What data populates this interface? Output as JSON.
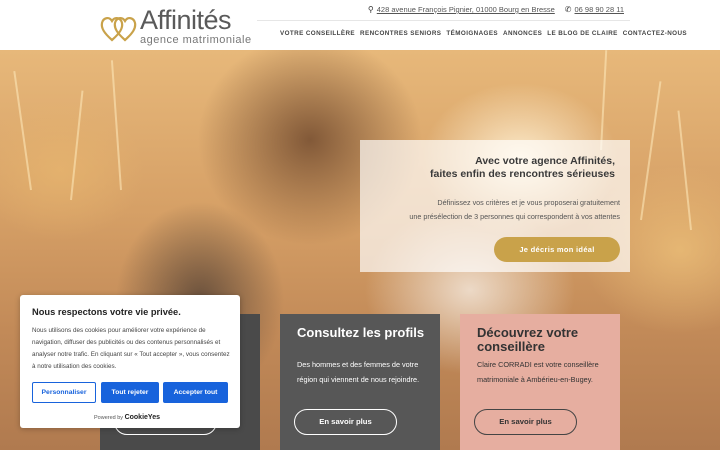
{
  "logo": {
    "title": "Affinités",
    "subtitle": "agence matrimoniale"
  },
  "topbar": {
    "address": "428 avenue François Pignier, 01000 Bourg en Bresse",
    "phone": "06 98 90 28 11"
  },
  "nav": [
    "VOTRE CONSEILLÈRE",
    "RENCONTRES SENIORS",
    "TÉMOIGNAGES",
    "ANNONCES",
    "LE BLOG DE CLAIRE",
    "CONTACTEZ-NOUS"
  ],
  "hero": {
    "title_line1": "Avec votre agence Affinités,",
    "title_line2": "faites enfin des rencontres sérieuses",
    "text_line1": "Définissez vos critères et je vous proposerai gratuitement",
    "text_line2": "une présélection de 3 personnes qui correspondent à vos attentes",
    "button": "Je décris mon idéal"
  },
  "cards": [
    {
      "title": "",
      "text": "",
      "button": ""
    },
    {
      "title": "Consultez les profils",
      "text": "Des hommes et des femmes de votre région qui viennent de nous rejoindre.",
      "button": "En savoir plus"
    },
    {
      "title": "Découvrez votre conseillère",
      "text": "Claire CORRADI est votre conseillère matrimoniale à Ambérieu-en-Bugey.",
      "button": "En savoir plus"
    }
  ],
  "cookie": {
    "title": "Nous respectons votre vie privée.",
    "text": "Nous utilisons des cookies pour améliorer votre expérience de navigation, diffuser des publicités ou des contenus personnalisés et analyser notre trafic. En cliquant sur « Tout accepter », vous consentez à notre utilisation des cookies.",
    "btn_customize": "Personnaliser",
    "btn_reject": "Tout rejeter",
    "btn_accept": "Accepter tout",
    "powered_prefix": "Powered by",
    "powered_brand": "CookieYes"
  },
  "colors": {
    "gold": "#c9a24a",
    "card_dark": "#575757",
    "card_pink": "#e6aea0",
    "cookie_blue": "#1863dc"
  },
  "icons": {
    "address": "map-pin-icon",
    "phone": "phone-icon",
    "logo": "hearts-logo-icon"
  }
}
